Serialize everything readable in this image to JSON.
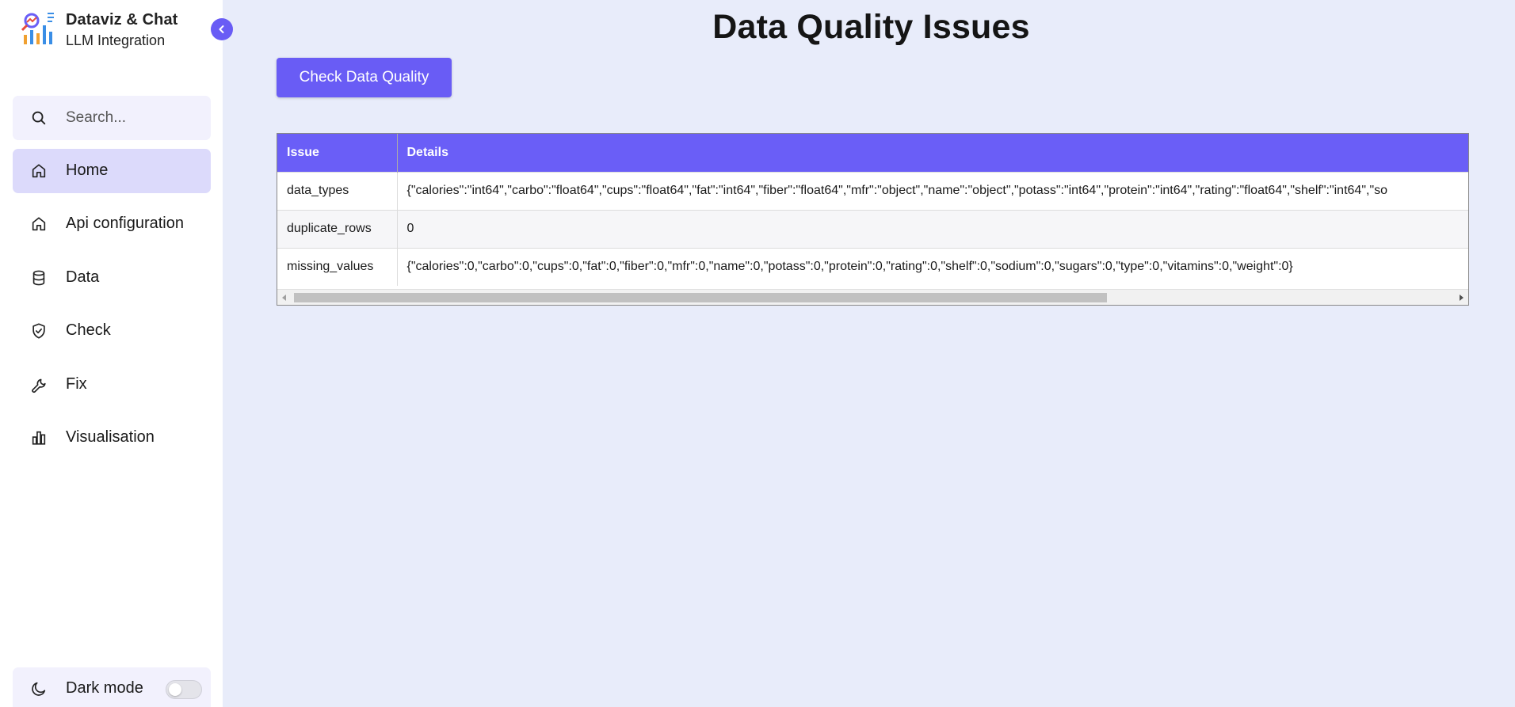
{
  "brand": {
    "title": "Dataviz & Chat",
    "subtitle": "LLM Integration",
    "logo_icon": "chart-logo-icon"
  },
  "sidebar": {
    "collapse_icon": "chevron-left-icon",
    "search": {
      "placeholder": "Search...",
      "value": "",
      "icon": "search-icon"
    },
    "items": [
      {
        "label": "Home",
        "icon": "home-icon",
        "active": true
      },
      {
        "label": "Api configuration",
        "icon": "home-icon",
        "active": false
      },
      {
        "label": "Data",
        "icon": "database-icon",
        "active": false
      },
      {
        "label": "Check",
        "icon": "shield-check-icon",
        "active": false
      },
      {
        "label": "Fix",
        "icon": "wrench-icon",
        "active": false
      },
      {
        "label": "Visualisation",
        "icon": "bar-chart-icon",
        "active": false
      }
    ],
    "dark_mode": {
      "label": "Dark mode",
      "icon": "moon-icon",
      "enabled": false
    }
  },
  "main": {
    "title": "Data Quality Issues",
    "check_button": "Check Data Quality",
    "table": {
      "headers": [
        "Issue",
        "Details"
      ],
      "rows": [
        {
          "issue": "data_types",
          "details": "{\"calories\":\"int64\",\"carbo\":\"float64\",\"cups\":\"float64\",\"fat\":\"int64\",\"fiber\":\"float64\",\"mfr\":\"object\",\"name\":\"object\",\"potass\":\"int64\",\"protein\":\"int64\",\"rating\":\"float64\",\"shelf\":\"int64\",\"so"
        },
        {
          "issue": "duplicate_rows",
          "details": "0"
        },
        {
          "issue": "missing_values",
          "details": "{\"calories\":0,\"carbo\":0,\"cups\":0,\"fat\":0,\"fiber\":0,\"mfr\":0,\"name\":0,\"potass\":0,\"protein\":0,\"rating\":0,\"shelf\":0,\"sodium\":0,\"sugars\":0,\"type\":0,\"vitamins\":0,\"weight\":0}"
        }
      ]
    }
  },
  "colors": {
    "accent": "#695cf5",
    "table_header": "#6a5ef7",
    "background": "#e8ecfa",
    "active_nav": "#dcdafb"
  }
}
